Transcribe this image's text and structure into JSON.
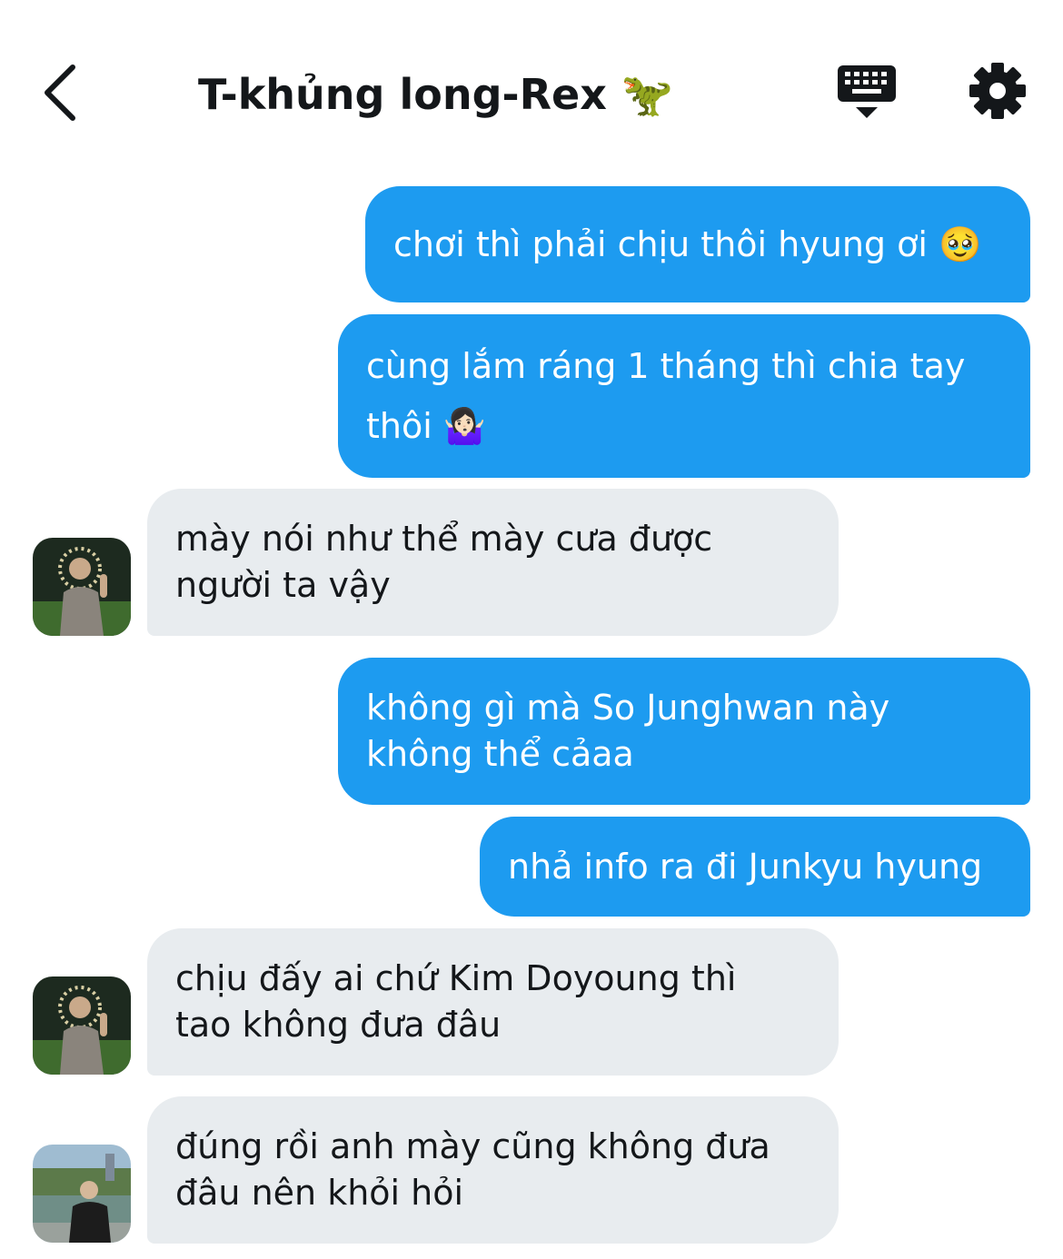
{
  "header": {
    "title": "T-khủng long-Rex 🦖"
  },
  "messages": [
    {
      "direction": "outgoing",
      "text": "chơi thì phải chịu thôi hyung ơi 🥹"
    },
    {
      "direction": "outgoing",
      "text": "cùng lắm ráng 1 tháng thì chia tay\nthôi 🤷🏻‍♀️"
    },
    {
      "direction": "incoming",
      "avatar": "avatar-rex",
      "text": "mày nói như thể mày cưa được\nngười ta vậy"
    },
    {
      "direction": "outgoing",
      "text": "không gì mà So Junghwan này\nkhông thể cảaa"
    },
    {
      "direction": "outgoing",
      "text": "nhả info ra đi Junkyu hyung"
    },
    {
      "direction": "incoming",
      "avatar": "avatar-rex",
      "text": "chịu đấy ai chứ Kim Doyoung thì\ntao không đưa đâu"
    },
    {
      "direction": "incoming",
      "avatar": "avatar-other",
      "text": "đúng rồi anh mày cũng không đưa\nđâu nên khỏi hỏi"
    }
  ],
  "icons": {
    "back": "chevron-left-icon",
    "keyboard": "keyboard-icon",
    "settings": "gear-icon"
  },
  "colors": {
    "outgoing_bubble": "#1d9bf0",
    "incoming_bubble": "#e8ecef",
    "text_dark": "#14171a"
  }
}
